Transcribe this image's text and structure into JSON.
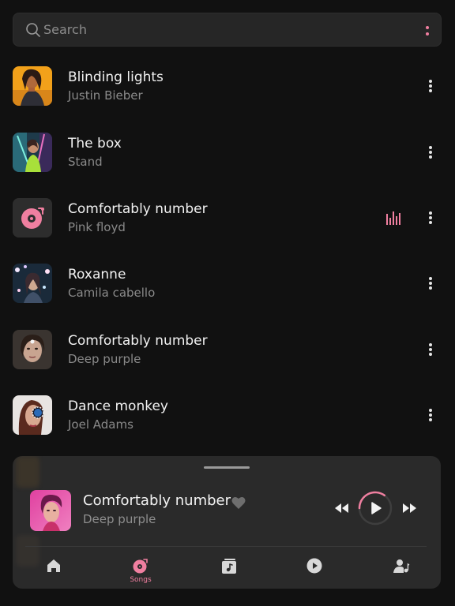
{
  "search": {
    "placeholder": "Search"
  },
  "colors": {
    "accent": "#f07fa0",
    "background": "#111111",
    "surface": "#262626"
  },
  "songs": [
    {
      "title": "Blinding lights",
      "artist": "Justin Bieber",
      "thumb": "photo-woman-yellow"
    },
    {
      "title": "The box",
      "artist": "Stand",
      "thumb": "photo-woman-neon"
    },
    {
      "title": "Comfortably number",
      "artist": "Pink floyd",
      "thumb": "vinyl-icon",
      "playing": true
    },
    {
      "title": "Roxanne",
      "artist": "Camila cabello",
      "thumb": "photo-woman-lights"
    },
    {
      "title": "Comfortably number",
      "artist": "Deep purple",
      "thumb": "photo-woman-portrait"
    },
    {
      "title": "Dance monkey",
      "artist": "Joel Adams",
      "thumb": "photo-woman-sunglasses"
    }
  ],
  "now_playing": {
    "title": "Comfortably number",
    "artist": "Deep purple",
    "progress": 0.35
  },
  "nav": {
    "items": [
      {
        "icon": "home-icon",
        "label": ""
      },
      {
        "icon": "vinyl-icon",
        "label": "Songs",
        "active": true
      },
      {
        "icon": "album-icon",
        "label": ""
      },
      {
        "icon": "play-circle-icon",
        "label": ""
      },
      {
        "icon": "artist-icon",
        "label": ""
      }
    ]
  }
}
